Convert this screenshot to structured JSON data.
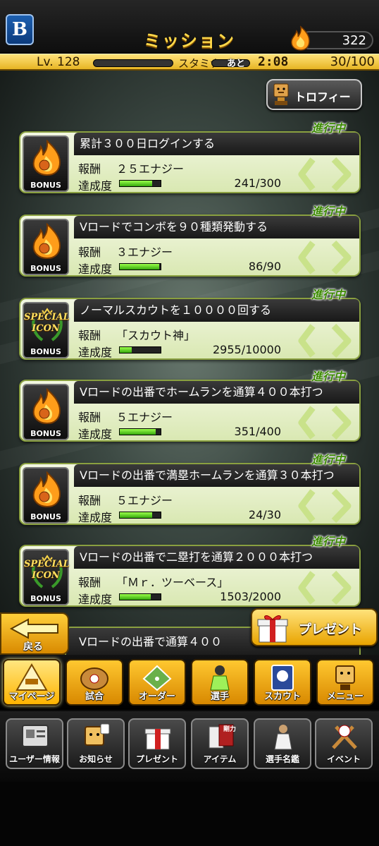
{
  "header": {
    "logo": "B",
    "title": "ミッション",
    "energy_count": "322",
    "level": "Lv. 128",
    "stamina_label": "スタミナ",
    "recover_label": "あと",
    "timer": "2:08",
    "stamina_value": "30/100"
  },
  "trophy_button": {
    "label": "トロフィー"
  },
  "missions": [
    {
      "title": "累計３００日ログインする",
      "reward_label": "報酬",
      "reward": "２５エナジー",
      "progress_label": "達成度",
      "progress": "241/300",
      "progress_fraction": 0.8,
      "status": "進行中",
      "icon": "energy-flame-icon",
      "bonus": "BONUS"
    },
    {
      "title": "Vロードでコンボを９０種類発動する",
      "reward_label": "報酬",
      "reward": "３エナジー",
      "progress_label": "達成度",
      "progress": "86/90",
      "progress_fraction": 0.96,
      "status": "進行中",
      "icon": "energy-flame-icon",
      "bonus": "BONUS"
    },
    {
      "title": "ノーマルスカウトを１００００回する",
      "reward_label": "報酬",
      "reward": "「スカウト神」",
      "progress_label": "達成度",
      "progress": "2955/10000",
      "progress_fraction": 0.3,
      "status": "進行中",
      "icon": "special-icon-badge",
      "special_text": "SPECIAL ICON",
      "bonus": "BONUS"
    },
    {
      "title": "Vロードの出番でホームランを通算４００本打つ",
      "reward_label": "報酬",
      "reward": "５エナジー",
      "progress_label": "達成度",
      "progress": "351/400",
      "progress_fraction": 0.88,
      "status": "進行中",
      "icon": "energy-flame-icon",
      "bonus": "BONUS"
    },
    {
      "title": "Vロードの出番で満塁ホームランを通算３０本打つ",
      "reward_label": "報酬",
      "reward": "５エナジー",
      "progress_label": "達成度",
      "progress": "24/30",
      "progress_fraction": 0.8,
      "status": "進行中",
      "icon": "energy-flame-icon",
      "bonus": "BONUS"
    },
    {
      "title": "Vロードの出番で二塁打を通算２０００本打つ",
      "reward_label": "報酬",
      "reward": "「Ｍｒ．ツーベース」",
      "progress_label": "達成度",
      "progress": "1503/2000",
      "progress_fraction": 0.75,
      "status": "進行中",
      "icon": "special-icon-badge",
      "special_text": "SPECIAL ICON",
      "bonus": "BONUS"
    }
  ],
  "partial_mission": {
    "title": "Vロードの出番で通算４００"
  },
  "back_button": {
    "label": "戻る"
  },
  "present_button": {
    "label": "プレゼント"
  },
  "nav_main": [
    {
      "label": "マイページ",
      "icon": "mypage-icon",
      "active": true
    },
    {
      "label": "試合",
      "icon": "baseball-glove-icon"
    },
    {
      "label": "オーダー",
      "icon": "field-order-icon"
    },
    {
      "label": "選手",
      "icon": "player-icon"
    },
    {
      "label": "スカウト",
      "icon": "scout-card-icon"
    },
    {
      "label": "メニュー",
      "icon": "mascot-menu-icon"
    }
  ],
  "nav_sub": [
    {
      "label": "ユーザー情報",
      "icon": "user-info-icon"
    },
    {
      "label": "お知らせ",
      "icon": "notice-icon"
    },
    {
      "label": "プレゼント",
      "icon": "gift-icon"
    },
    {
      "label": "アイテム",
      "icon": "item-icon",
      "tag": "剛力"
    },
    {
      "label": "選手名鑑",
      "icon": "player-directory-icon"
    },
    {
      "label": "イベント",
      "icon": "event-bats-icon"
    }
  ],
  "colors": {
    "gold": "#ffd84a",
    "progress_green": "#35a80d",
    "status_green": "#3b8a00"
  }
}
